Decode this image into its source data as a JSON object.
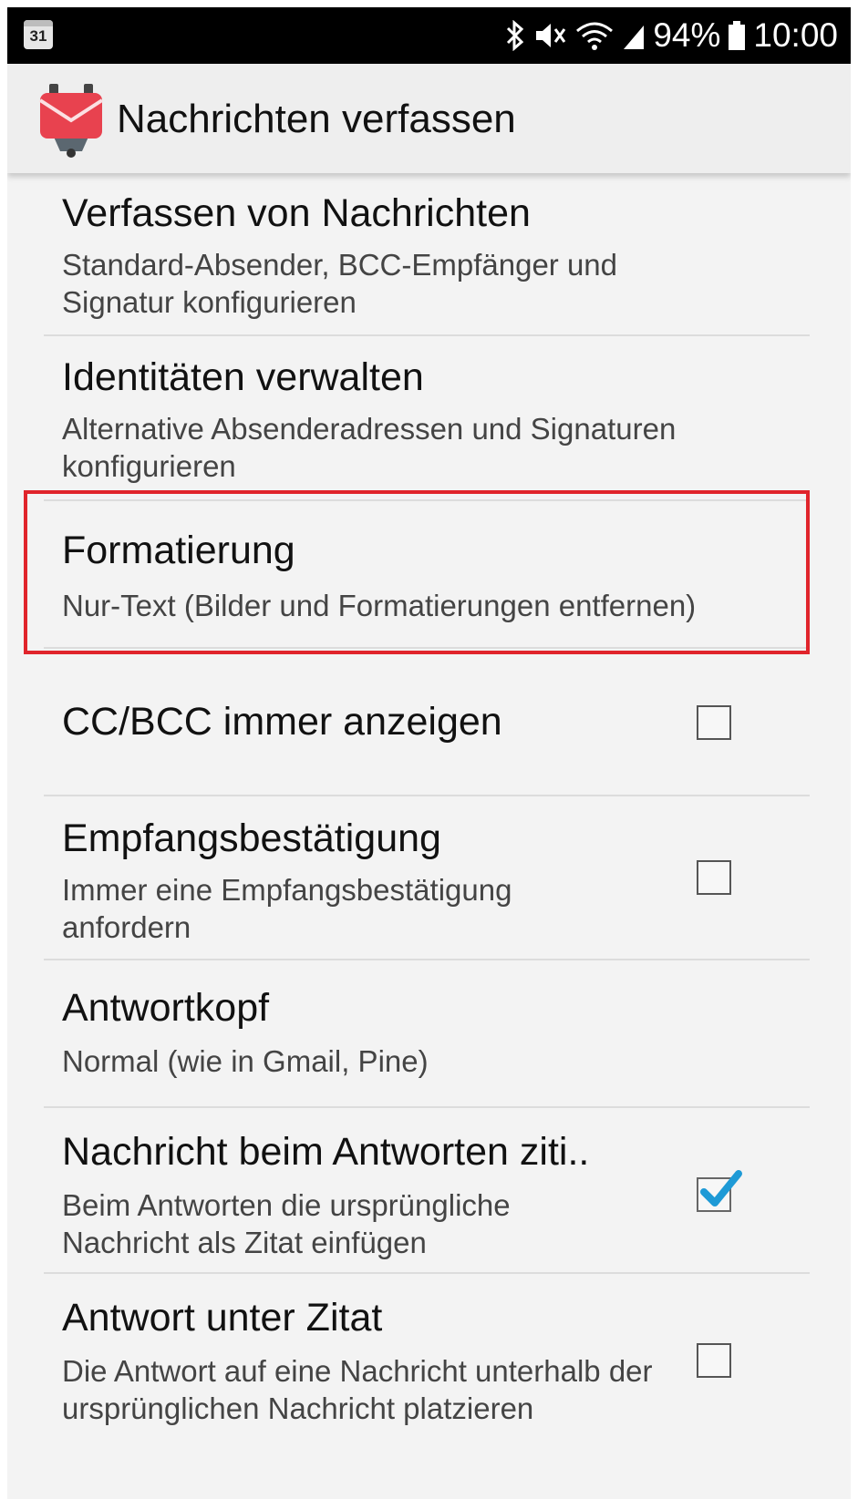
{
  "status_bar": {
    "calendar_day": "31",
    "battery_percent": "94%",
    "time": "10:00"
  },
  "app_bar": {
    "title": "Nachrichten verfassen"
  },
  "settings": [
    {
      "title": "Verfassen von Nachrichten",
      "subtitle": "Standard-Absender, BCC-Empfänger und Signatur konfigurieren"
    },
    {
      "title": "Identitäten verwalten",
      "subtitle": "Alternative Absenderadressen und Signaturen konfigurieren"
    },
    {
      "title": "Formatierung",
      "subtitle": "Nur-Text (Bilder und Formatierungen entfernen)",
      "highlighted": true
    },
    {
      "title": "CC/BCC immer anzeigen",
      "checked": false
    },
    {
      "title": "Empfangsbestätigung",
      "subtitle": "Immer eine Empfangsbestätigung anfordern",
      "checked": false
    },
    {
      "title": "Antwortkopf",
      "subtitle": "Normal (wie in Gmail, Pine)"
    },
    {
      "title": "Nachricht beim Antworten ziti..",
      "subtitle": "Beim Antworten die ursprüngliche Nachricht als Zitat einfügen",
      "checked": true
    },
    {
      "title": "Antwort unter Zitat",
      "subtitle": "Die Antwort auf eine Nachricht unterhalb der ursprünglichen Nachricht platzieren",
      "checked": false
    }
  ],
  "colors": {
    "accent_check": "#1e9ad6",
    "highlight_border": "#e0242b",
    "logo_red": "#e8424f"
  }
}
